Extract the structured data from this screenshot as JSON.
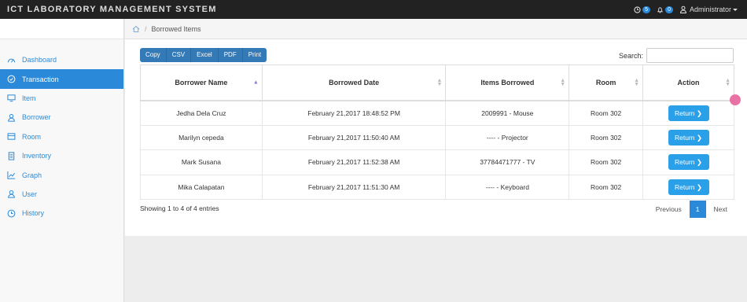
{
  "app": {
    "title": "ICT LABORATORY MANAGEMENT SYSTEM",
    "clock_badge": "5",
    "bell_badge": "0",
    "user": "Administrator"
  },
  "sidebar": {
    "items": [
      {
        "label": "Dashboard",
        "icon": "dashboard-icon"
      },
      {
        "label": "Transaction",
        "icon": "transaction-icon",
        "active": true
      },
      {
        "label": "Item",
        "icon": "monitor-icon"
      },
      {
        "label": "Borrower",
        "icon": "user-icon"
      },
      {
        "label": "Room",
        "icon": "room-icon"
      },
      {
        "label": "Inventory",
        "icon": "inventory-icon"
      },
      {
        "label": "Graph",
        "icon": "graph-icon"
      },
      {
        "label": "User",
        "icon": "user-icon"
      },
      {
        "label": "History",
        "icon": "history-icon"
      }
    ]
  },
  "breadcrumb": {
    "current": "Borrowed Items"
  },
  "toolbar": {
    "buttons": [
      "Copy",
      "CSV",
      "Excel",
      "PDF",
      "Print"
    ],
    "search_label": "Search:",
    "search_value": ""
  },
  "table": {
    "headers": [
      "Borrower Name",
      "Borrowed Date",
      "Items Borrowed",
      "Room",
      "Action"
    ],
    "rows": [
      {
        "borrower": "Jedha Dela Cruz",
        "date": "February 21,2017 18:48:52 PM",
        "item": "2009991 - Mouse",
        "room": "Room 302",
        "action": "Return"
      },
      {
        "borrower": "Marilyn cepeda",
        "date": "February 21,2017 11:50:40 AM",
        "item": "---- - Projector",
        "room": "Room 302",
        "action": "Return"
      },
      {
        "borrower": "Mark Susana",
        "date": "February 21,2017 11:52:38 AM",
        "item": "37784471777 - TV",
        "room": "Room 302",
        "action": "Return"
      },
      {
        "borrower": "Mika Calapatan",
        "date": "February 21,2017 11:51:30 AM",
        "item": "---- - Keyboard",
        "room": "Room 302",
        "action": "Return"
      }
    ]
  },
  "footer": {
    "info": "Showing 1 to 4 of 4 entries",
    "previous": "Previous",
    "page": "1",
    "next": "Next"
  },
  "colors": {
    "accent": "#2a8ad9",
    "navbar": "#222222"
  }
}
